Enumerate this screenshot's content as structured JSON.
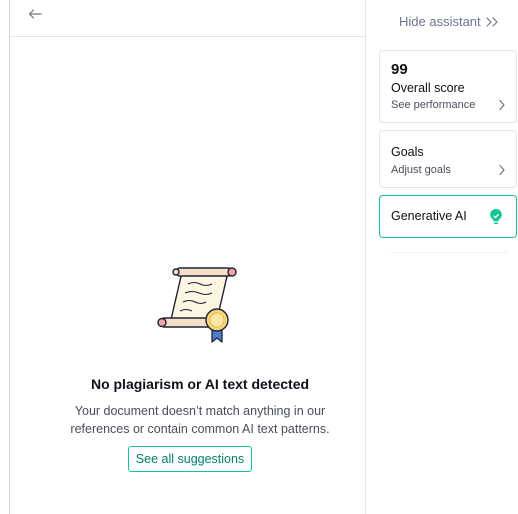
{
  "main": {
    "empty_state": {
      "title": "No plagiarism or AI text detected",
      "description_line1": "Your document doesn’t match anything in our",
      "description_line2": "references or contain common AI text patterns.",
      "cta_label": "See all suggestions"
    },
    "icons": {
      "back": "arrow-left-icon",
      "illustration": "scroll-certificate-icon"
    }
  },
  "assistant": {
    "hide_label": "Hide assistant",
    "cards": {
      "score": {
        "value": "99",
        "label": "Overall score",
        "link": "See performance"
      },
      "goals": {
        "title": "Goals",
        "link": "Adjust goals"
      },
      "generative_ai": {
        "label": "Generative AI",
        "icon": "lightbulb-icon"
      }
    }
  },
  "colors": {
    "accent": "#15c39a",
    "accent_text": "#027e6f",
    "muted_text": "#6d758d",
    "border": "#e3e5ea"
  }
}
